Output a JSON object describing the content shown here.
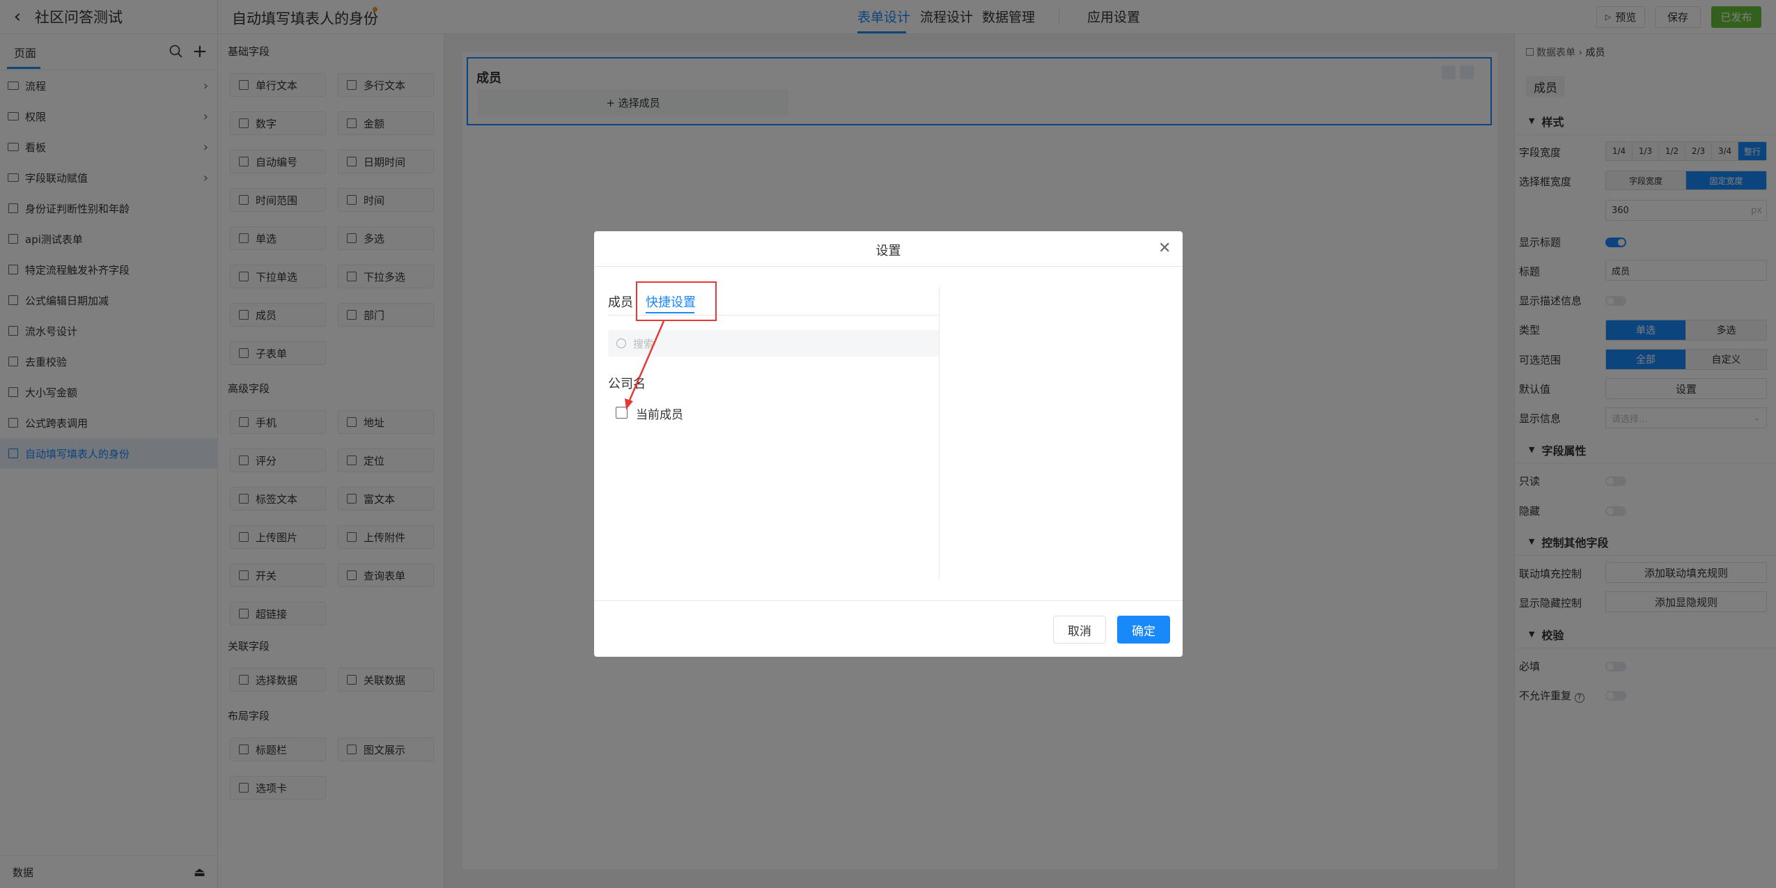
{
  "app": {
    "title": "社区问答测试"
  },
  "sidebar": {
    "page_tab": "页面",
    "items": [
      {
        "label": "流程",
        "type": "folder"
      },
      {
        "label": "权限",
        "type": "folder"
      },
      {
        "label": "看板",
        "type": "folder"
      },
      {
        "label": "字段联动赋值",
        "type": "folder"
      },
      {
        "label": "身份证判断性别和年龄",
        "type": "form"
      },
      {
        "label": "api测试表单",
        "type": "form"
      },
      {
        "label": "特定流程触发补齐字段",
        "type": "form"
      },
      {
        "label": "公式编辑日期加减",
        "type": "form"
      },
      {
        "label": "流水号设计",
        "type": "form"
      },
      {
        "label": "去重校验",
        "type": "form"
      },
      {
        "label": "大小写金额",
        "type": "form"
      },
      {
        "label": "公式跨表调用",
        "type": "form"
      },
      {
        "label": "自动填写填表人的身份",
        "type": "form",
        "active": true
      }
    ],
    "footer_label": "数据"
  },
  "topbar": {
    "doc_title": "自动填写填表人的身份",
    "tabs": [
      "表单设计",
      "流程设计",
      "数据管理",
      "应用设置"
    ],
    "active_tab": "表单设计",
    "preview": "预览",
    "save": "保存",
    "publish": "已发布"
  },
  "palette": {
    "sections": [
      {
        "title": "基础字段",
        "fields": [
          "单行文本",
          "多行文本",
          "数字",
          "金额",
          "自动编号",
          "日期时间",
          "时间范围",
          "时间",
          "单选",
          "多选",
          "下拉单选",
          "下拉多选",
          "成员",
          "部门",
          "子表单"
        ]
      },
      {
        "title": "高级字段",
        "fields": [
          "手机",
          "地址",
          "评分",
          "定位",
          "标签文本",
          "富文本",
          "上传图片",
          "上传附件",
          "开关",
          "查询表单",
          "超链接"
        ]
      },
      {
        "title": "关联字段",
        "fields": [
          "选择数据",
          "关联数据"
        ]
      },
      {
        "title": "布局字段",
        "fields": [
          "标题栏",
          "图文展示",
          "选项卡"
        ]
      }
    ]
  },
  "canvas": {
    "field_title": "成员",
    "pick_button": "+ 选择成员"
  },
  "right_panel": {
    "breadcrumb_parent": "数据表单",
    "breadcrumb_current": "成员",
    "field_chip": "成员",
    "group_style": "样式",
    "field_width_label": "字段宽度",
    "field_width_options": [
      "1/4",
      "1/3",
      "1/2",
      "2/3",
      "3/4",
      "整行"
    ],
    "box_width_label": "选择框宽度",
    "box_width_options": [
      "字段宽度",
      "固定宽度"
    ],
    "box_width_value": "360",
    "box_width_unit": "px",
    "show_title_label": "显示标题",
    "title_label": "标题",
    "title_value": "成员",
    "show_desc_label": "显示描述信息",
    "type_label": "类型",
    "type_options": [
      "单选",
      "多选"
    ],
    "range_label": "可选范围",
    "range_options": [
      "全部",
      "自定义"
    ],
    "default_label": "默认值",
    "default_button": "设置",
    "display_info_label": "显示信息",
    "display_info_placeholder": "请选择...",
    "group_attr": "字段属性",
    "readonly_label": "只读",
    "hidden_label": "隐藏",
    "group_control": "控制其他字段",
    "linkage_label": "联动填充控制",
    "linkage_button": "添加联动填充规则",
    "showhide_label": "显示隐藏控制",
    "showhide_button": "添加显隐规则",
    "group_validate": "校验",
    "required_label": "必填",
    "unique_label": "不允许重复"
  },
  "dialog": {
    "title": "设置",
    "tab_member": "成员",
    "tab_quick": "快捷设置",
    "search_placeholder": "搜索",
    "company": "公司名",
    "option_current_member": "当前成员",
    "cancel": "取消",
    "ok": "确定"
  },
  "colors": {
    "accent": "#1989fa",
    "publish": "#67c23a",
    "highlight": "#e53935"
  }
}
